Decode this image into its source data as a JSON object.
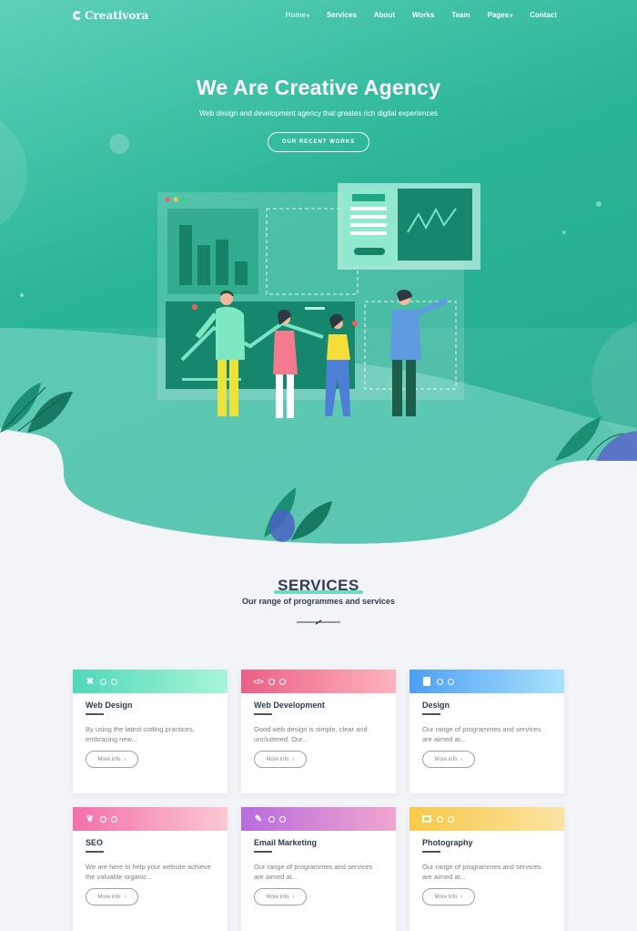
{
  "nav": {
    "logo": "Creativora",
    "items": [
      {
        "label": "Home",
        "dropdown": true,
        "active": true
      },
      {
        "label": "Services",
        "dropdown": false,
        "active": false
      },
      {
        "label": "About",
        "dropdown": false,
        "active": false
      },
      {
        "label": "Works",
        "dropdown": false,
        "active": false
      },
      {
        "label": "Team",
        "dropdown": false,
        "active": false
      },
      {
        "label": "Pages",
        "dropdown": true,
        "active": false
      },
      {
        "label": "Contact",
        "dropdown": false,
        "active": false
      }
    ]
  },
  "hero": {
    "title": "We Are Creative Agency",
    "subtitle": "Web design and development agency that greates rich digital experiences",
    "button": "OUR RECENT WORKS"
  },
  "services": {
    "title": "SERVICES",
    "subtitle": "Our range of programmes and services",
    "cards": [
      {
        "title": "Web Design",
        "text": "By using the latest coding practices, embracing new...",
        "button": "More info",
        "icon": "close-x-icon",
        "gradient": [
          "#4fd8b8",
          "#a9f5d9"
        ]
      },
      {
        "title": "Web Development",
        "text": "Good web design is simple, clear and uncluttered. Our...",
        "button": "More info",
        "icon": "code-icon",
        "gradient": [
          "#ec5f86",
          "#fcb3bd"
        ]
      },
      {
        "title": "Design",
        "text": "Our range of programmes and services are aimed at...",
        "button": "More info",
        "icon": "tablet-icon",
        "gradient": [
          "#4d9ff5",
          "#a9e2fb"
        ]
      },
      {
        "title": "SEO",
        "text": "We are here to help your website achieve the valuable organic...",
        "button": "More info",
        "icon": "sprout-icon",
        "gradient": [
          "#f36fa9",
          "#fbc9d4"
        ]
      },
      {
        "title": "Email Marketing",
        "text": "Our range of programmes and services are aimed at...",
        "button": "More info",
        "icon": "pen-icon",
        "gradient": [
          "#b86bdd",
          "#f0a6cf"
        ]
      },
      {
        "title": "Photography",
        "text": "Our range of programmes and services are aimed at...",
        "button": "More info",
        "icon": "camera-icon",
        "gradient": [
          "#f7c948",
          "#fbe3a2"
        ]
      }
    ]
  }
}
